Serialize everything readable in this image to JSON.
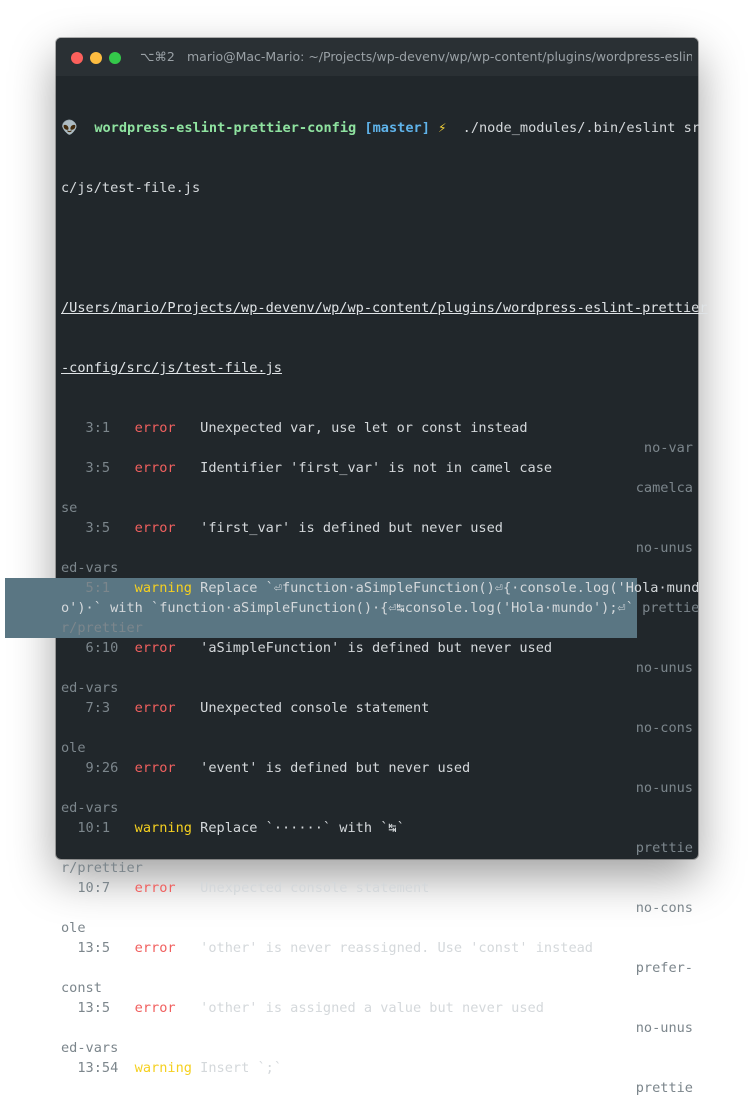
{
  "window": {
    "shortcut": "⌥⌘2",
    "title": "mario@Mac-Mario: ~/Projects/wp-devenv/wp/wp-content/plugins/wordpress-eslint..."
  },
  "prompt": {
    "icon": "alien-icon",
    "dir": "wordpress-eslint-prettier-config",
    "branch": "[master]",
    "bolt": "⚡",
    "command_1": "  ./node_modules/.bin/eslint sr",
    "command_2": "c/js/test-file.js"
  },
  "report": {
    "file_1": "/Users/mario/Projects/wp-devenv/wp/wp-content/plugins/wordpress-eslint-prettier",
    "file_2": "-config/src/js/test-file.js",
    "items": [
      {
        "loc": "   3:1 ",
        "severity": "error",
        "sev_pad": "   ",
        "message": "Unexpected var, use let or const instead",
        "rule_right": "no-var",
        "rule_wrap": ""
      },
      {
        "loc": "   3:5 ",
        "severity": "error",
        "sev_pad": "   ",
        "message": "Identifier 'first_var' is not in camel case",
        "rule_right": "camelca",
        "rule_wrap": "se"
      },
      {
        "loc": "   3:5 ",
        "severity": "error",
        "sev_pad": "   ",
        "message": "'first_var' is defined but never used",
        "rule_right": "no-unus",
        "rule_wrap": "ed-vars"
      },
      {
        "loc": "   5:1 ",
        "severity": "warning",
        "sev_pad": " ",
        "message": "Replace `⏎function·aSimpleFunction()⏎{·console.log('Hola·mund",
        "message2": "o')·` with `function·aSimpleFunction()·{⏎↹console.log('Hola·mundo');⏎`",
        "rule_right": "prettie",
        "rule_wrap": "r/prettier"
      },
      {
        "loc": "   6:10",
        "severity": "error",
        "sev_pad": "   ",
        "message": "'aSimpleFunction' is defined but never used",
        "rule_right": "no-unus",
        "rule_wrap": "ed-vars"
      },
      {
        "loc": "   7:3 ",
        "severity": "error",
        "sev_pad": "   ",
        "message": "Unexpected console statement",
        "rule_right": "no-cons",
        "rule_wrap": "ole"
      },
      {
        "loc": "   9:26",
        "severity": "error",
        "sev_pad": "   ",
        "message": "'event' is defined but never used",
        "rule_right": "no-unus",
        "rule_wrap": "ed-vars"
      },
      {
        "loc": "  10:1 ",
        "severity": "warning",
        "sev_pad": " ",
        "message": "Replace `······` with `↹`",
        "rule_right": "prettie",
        "rule_wrap": "r/prettier",
        "highlighted": true
      },
      {
        "loc": "  10:7 ",
        "severity": "error",
        "sev_pad": "   ",
        "message": "Unexpected console statement",
        "rule_right": "no-cons",
        "rule_wrap": "ole"
      },
      {
        "loc": "  13:5 ",
        "severity": "error",
        "sev_pad": "   ",
        "message": "'other' is never reassigned. Use 'const' instead",
        "rule_right": "prefer-",
        "rule_wrap": "const"
      },
      {
        "loc": "  13:5 ",
        "severity": "error",
        "sev_pad": "   ",
        "message": "'other' is assigned a value but never used",
        "rule_right": "no-unus",
        "rule_wrap": "ed-vars"
      },
      {
        "loc": "  13:54",
        "severity": "warning",
        "sev_pad": " ",
        "message": "Insert `;`",
        "rule_right": "prettie",
        "rule_wrap": ""
      }
    ]
  },
  "colors": {
    "terminal_bg": "#21272b",
    "error": "#f0605f",
    "warning": "#f5d020",
    "highlight": "#5a7683",
    "prompt_dir": "#8fe3a0",
    "branch": "#5fb3ea"
  }
}
